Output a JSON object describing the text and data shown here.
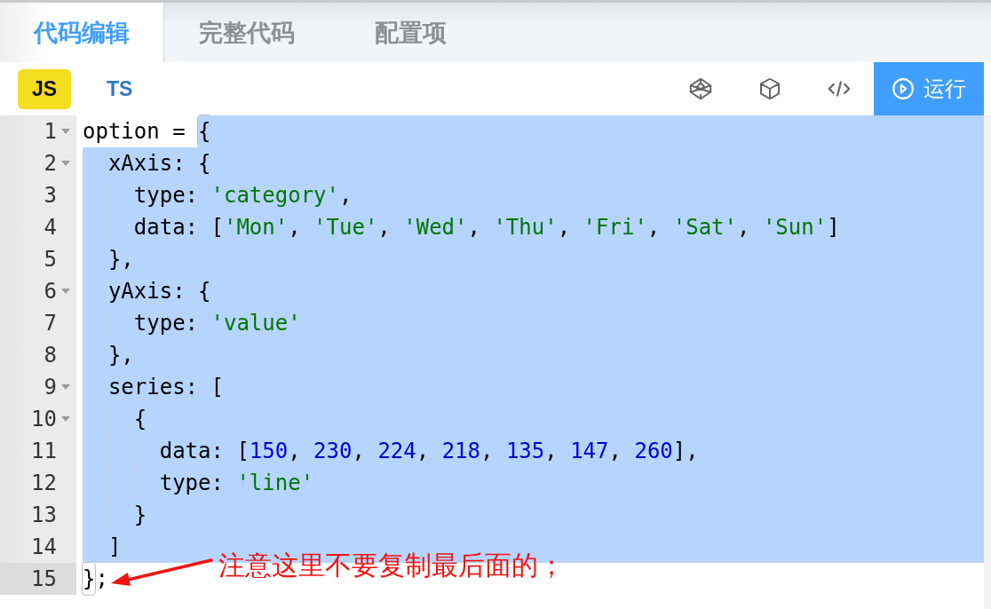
{
  "tabs": [
    {
      "label": "代码编辑",
      "selected": true
    },
    {
      "label": "完整代码",
      "selected": false
    },
    {
      "label": "配置项",
      "selected": false
    }
  ],
  "languages": [
    {
      "label": "JS",
      "selected": true
    },
    {
      "label": "TS",
      "selected": false
    }
  ],
  "run_button": {
    "label": "运行"
  },
  "editor": {
    "lines": [
      {
        "number": "1",
        "foldable": true,
        "active": false,
        "tokens": [
          {
            "kind": "plain",
            "text": "option = ",
            "selected": false
          },
          {
            "kind": "match",
            "text": "{",
            "selected": true
          }
        ]
      },
      {
        "number": "2",
        "foldable": true,
        "active": false,
        "tokens": [
          {
            "kind": "plain",
            "text": "  xAxis: {",
            "selected": true
          }
        ]
      },
      {
        "number": "3",
        "foldable": false,
        "active": false,
        "tokens": [
          {
            "kind": "plain",
            "text": "    type: ",
            "selected": true
          },
          {
            "kind": "string",
            "text": "'category'",
            "selected": true
          },
          {
            "kind": "plain",
            "text": ",",
            "selected": true
          }
        ]
      },
      {
        "number": "4",
        "foldable": false,
        "active": false,
        "tokens": [
          {
            "kind": "plain",
            "text": "    data: [",
            "selected": true
          },
          {
            "kind": "string",
            "text": "'Mon'",
            "selected": true
          },
          {
            "kind": "plain",
            "text": ", ",
            "selected": true
          },
          {
            "kind": "string",
            "text": "'Tue'",
            "selected": true
          },
          {
            "kind": "plain",
            "text": ", ",
            "selected": true
          },
          {
            "kind": "string",
            "text": "'Wed'",
            "selected": true
          },
          {
            "kind": "plain",
            "text": ", ",
            "selected": true
          },
          {
            "kind": "string",
            "text": "'Thu'",
            "selected": true
          },
          {
            "kind": "plain",
            "text": ", ",
            "selected": true
          },
          {
            "kind": "string",
            "text": "'Fri'",
            "selected": true
          },
          {
            "kind": "plain",
            "text": ", ",
            "selected": true
          },
          {
            "kind": "string",
            "text": "'Sat'",
            "selected": true
          },
          {
            "kind": "plain",
            "text": ", ",
            "selected": true
          },
          {
            "kind": "string",
            "text": "'Sun'",
            "selected": true
          },
          {
            "kind": "plain",
            "text": "]",
            "selected": true
          }
        ]
      },
      {
        "number": "5",
        "foldable": false,
        "active": false,
        "tokens": [
          {
            "kind": "plain",
            "text": "  },",
            "selected": true
          }
        ]
      },
      {
        "number": "6",
        "foldable": true,
        "active": false,
        "tokens": [
          {
            "kind": "plain",
            "text": "  yAxis: {",
            "selected": true
          }
        ]
      },
      {
        "number": "7",
        "foldable": false,
        "active": false,
        "tokens": [
          {
            "kind": "plain",
            "text": "    type: ",
            "selected": true
          },
          {
            "kind": "string",
            "text": "'value'",
            "selected": true
          }
        ]
      },
      {
        "number": "8",
        "foldable": false,
        "active": false,
        "tokens": [
          {
            "kind": "plain",
            "text": "  },",
            "selected": true
          }
        ]
      },
      {
        "number": "9",
        "foldable": true,
        "active": false,
        "tokens": [
          {
            "kind": "plain",
            "text": "  series: [",
            "selected": true
          }
        ]
      },
      {
        "number": "10",
        "foldable": true,
        "active": false,
        "tokens": [
          {
            "kind": "plain",
            "text": "    {",
            "selected": true
          }
        ]
      },
      {
        "number": "11",
        "foldable": false,
        "active": false,
        "tokens": [
          {
            "kind": "plain",
            "text": "      data: [",
            "selected": true
          },
          {
            "kind": "number",
            "text": "150",
            "selected": true
          },
          {
            "kind": "plain",
            "text": ", ",
            "selected": true
          },
          {
            "kind": "number",
            "text": "230",
            "selected": true
          },
          {
            "kind": "plain",
            "text": ", ",
            "selected": true
          },
          {
            "kind": "number",
            "text": "224",
            "selected": true
          },
          {
            "kind": "plain",
            "text": ", ",
            "selected": true
          },
          {
            "kind": "number",
            "text": "218",
            "selected": true
          },
          {
            "kind": "plain",
            "text": ", ",
            "selected": true
          },
          {
            "kind": "number",
            "text": "135",
            "selected": true
          },
          {
            "kind": "plain",
            "text": ", ",
            "selected": true
          },
          {
            "kind": "number",
            "text": "147",
            "selected": true
          },
          {
            "kind": "plain",
            "text": ", ",
            "selected": true
          },
          {
            "kind": "number",
            "text": "260",
            "selected": true
          },
          {
            "kind": "plain",
            "text": "],",
            "selected": true
          }
        ]
      },
      {
        "number": "12",
        "foldable": false,
        "active": false,
        "tokens": [
          {
            "kind": "plain",
            "text": "      type: ",
            "selected": true
          },
          {
            "kind": "string",
            "text": "'line'",
            "selected": true
          }
        ]
      },
      {
        "number": "13",
        "foldable": false,
        "active": false,
        "tokens": [
          {
            "kind": "plain",
            "text": "    }",
            "selected": true
          }
        ]
      },
      {
        "number": "14",
        "foldable": false,
        "active": false,
        "tokens": [
          {
            "kind": "plain",
            "text": "  ]",
            "selected": true
          }
        ]
      },
      {
        "number": "15",
        "foldable": false,
        "active": true,
        "tokens": [
          {
            "kind": "match",
            "text": "}",
            "selected": false
          },
          {
            "kind": "plain",
            "text": ";",
            "selected": false
          }
        ]
      }
    ]
  },
  "annotation": {
    "text": "注意这里不要复制最后面的；"
  }
}
